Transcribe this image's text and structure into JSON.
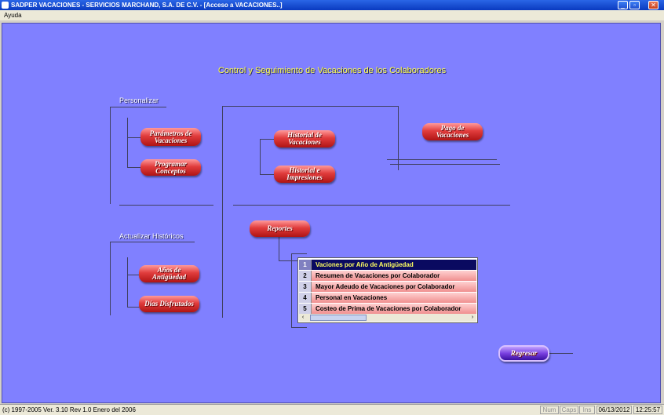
{
  "window": {
    "title": "SADPER VACACIONES -  SERVICIOS MARCHAND, S.A. DE C.V. - [Acceso a VACACIONES..]",
    "minimize_glyph": "_",
    "restore_glyph": "▫",
    "close_glyph": "✕"
  },
  "menu": {
    "ayuda": "Ayuda"
  },
  "main": {
    "title": "Control y Seguimiento de Vacaciones de los Colaboradores",
    "personalizar_label": "Personalizar",
    "actualizar_label": "Actualizar Históricos",
    "buttons": {
      "parametros": "Parámetros de Vacaciones",
      "programar": "Programar Conceptos",
      "historial_vacaciones": "Historial de Vacaciones",
      "historial_impresiones": "Historial e Impresiones",
      "pago": "Pago de Vacaciones",
      "reportes": "Reportes",
      "anios": "Años de Antigüedad",
      "dias": "Días Disfrutados",
      "regresar": "Regresar"
    },
    "reports": [
      {
        "num": "1",
        "label": "Vaciones por Año de Antigüedad",
        "selected": true
      },
      {
        "num": "2",
        "label": "Resumen de Vacaciones por Colaborador"
      },
      {
        "num": "3",
        "label": "Mayor Adeudo de Vacaciones por Colaborador"
      },
      {
        "num": "4",
        "label": "Personal en Vacaciones"
      },
      {
        "num": "5",
        "label": "Costeo de Prima de Vacaciones por Colaborador"
      }
    ],
    "scroll_left": "‹",
    "scroll_right": "›"
  },
  "status": {
    "text": "(c) 1997-2005  Ver. 3.10 Rev 1.0  Enero del 2006",
    "num": "Num",
    "caps": "Caps",
    "ins": "Ins",
    "date": "06/13/2012",
    "time": "12:25:57"
  },
  "colors": {
    "workspace": "#8080ff",
    "title_text": "#ffff40",
    "button_red": "#e03c3c",
    "button_purple": "#7a40e0",
    "list_selected": "#0a0a60"
  }
}
